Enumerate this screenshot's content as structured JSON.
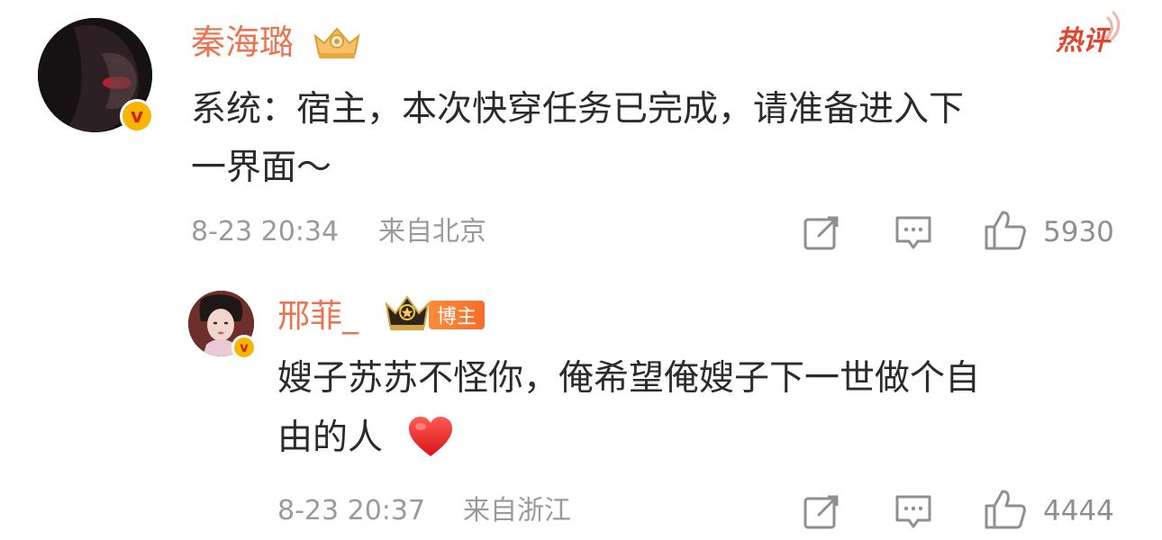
{
  "hot_label": "热评",
  "comments": [
    {
      "username": "秦海璐",
      "avatar_icon": "avatar-photo",
      "verified_icon": "verified-v-badge",
      "crown_icon": "crown-vip-icon",
      "verified_mark": "v",
      "text_line1": "系统：宿主，本次快穿任务已完成，请准备进入下",
      "text_line2": "一界面～",
      "time": "8-23 20:34",
      "location": "来自北京",
      "like_count": "5930"
    },
    {
      "username": "邢菲_",
      "avatar_icon": "avatar-photo",
      "verified_icon": "verified-v-badge",
      "crown_icon": "crown-vip-icon",
      "badge_label": "博主",
      "verified_mark": "v",
      "text_line1": "嫂子苏苏不怪你，俺希望俺嫂子下一世做个自",
      "text_line2": "由的人",
      "emoji": "❤️",
      "time": "8-23 20:37",
      "location": "来自浙江",
      "like_count": "4444"
    }
  ],
  "colors": {
    "username": "#eb7350",
    "text": "#2b2b2b",
    "meta": "#9a9a9a",
    "hot": "#e2452d",
    "verified": "#f7b500",
    "badge": "#f66d2a"
  }
}
